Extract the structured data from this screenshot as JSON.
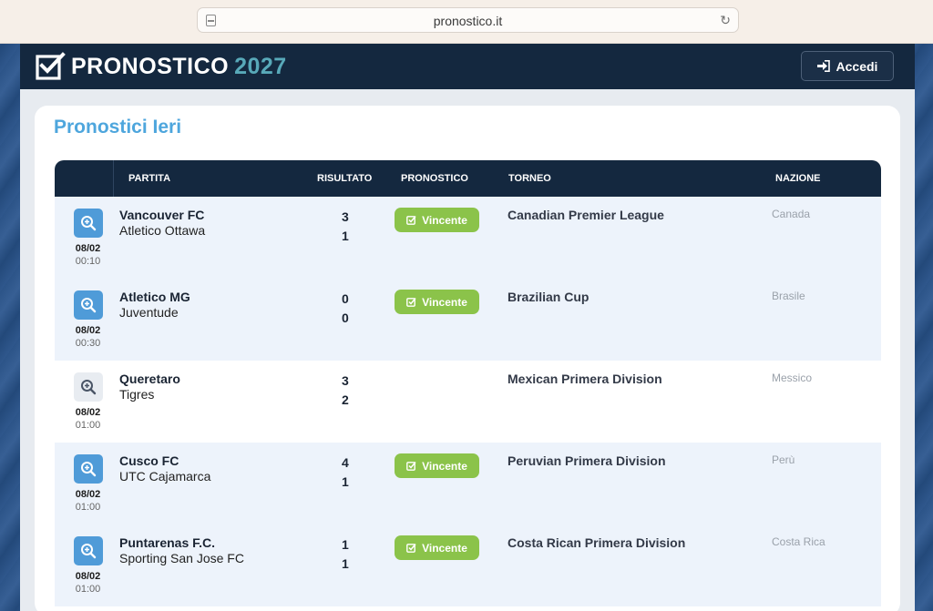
{
  "browser": {
    "url": "pronostico.it"
  },
  "header": {
    "logo_text": "PRONOSTICO",
    "logo_year": "2027",
    "login_label": "Accedi"
  },
  "page": {
    "title": "Pronostici Ieri"
  },
  "table": {
    "columns": {
      "match": "PARTITA",
      "result": "RISULTATO",
      "prediction": "PRONOSTICO",
      "tournament": "TORNEO",
      "nation": "NAZIONE"
    },
    "rows": [
      {
        "date": "08/02",
        "time": "00:10",
        "home": "Vancouver FC",
        "away": "Atletico Ottawa",
        "home_score": "3",
        "away_score": "1",
        "prediction": "Vincente",
        "tournament": "Canadian Premier League",
        "nation": "Canada"
      },
      {
        "date": "08/02",
        "time": "00:30",
        "home": "Atletico MG",
        "away": "Juventude",
        "home_score": "0",
        "away_score": "0",
        "prediction": "Vincente",
        "tournament": "Brazilian Cup",
        "nation": "Brasile"
      },
      {
        "date": "08/02",
        "time": "01:00",
        "home": "Queretaro",
        "away": "Tigres",
        "home_score": "3",
        "away_score": "2",
        "prediction": "",
        "tournament": "Mexican Primera Division",
        "nation": "Messico"
      },
      {
        "date": "08/02",
        "time": "01:00",
        "home": "Cusco FC",
        "away": "UTC Cajamarca",
        "home_score": "4",
        "away_score": "1",
        "prediction": "Vincente",
        "tournament": "Peruvian Primera Division",
        "nation": "Perù"
      },
      {
        "date": "08/02",
        "time": "01:00",
        "home": "Puntarenas F.C.",
        "away": "Sporting San Jose FC",
        "home_score": "1",
        "away_score": "1",
        "prediction": "Vincente",
        "tournament": "Costa Rican Primera Division",
        "nation": "Costa Rica"
      }
    ]
  },
  "icons": {
    "logo": "checkbox-icon",
    "login": "sign-in-icon",
    "zoom": "zoom-in-icon",
    "prediction": "check-square-icon",
    "tab": "tab-overview-icon",
    "reload": "reload-icon"
  },
  "colors": {
    "header_bg": "#14283f",
    "accent_blue": "#4ea6dd",
    "year_teal": "#58a9b9",
    "badge_green": "#8bc34a",
    "zoom_blue": "#4f9bd8"
  }
}
